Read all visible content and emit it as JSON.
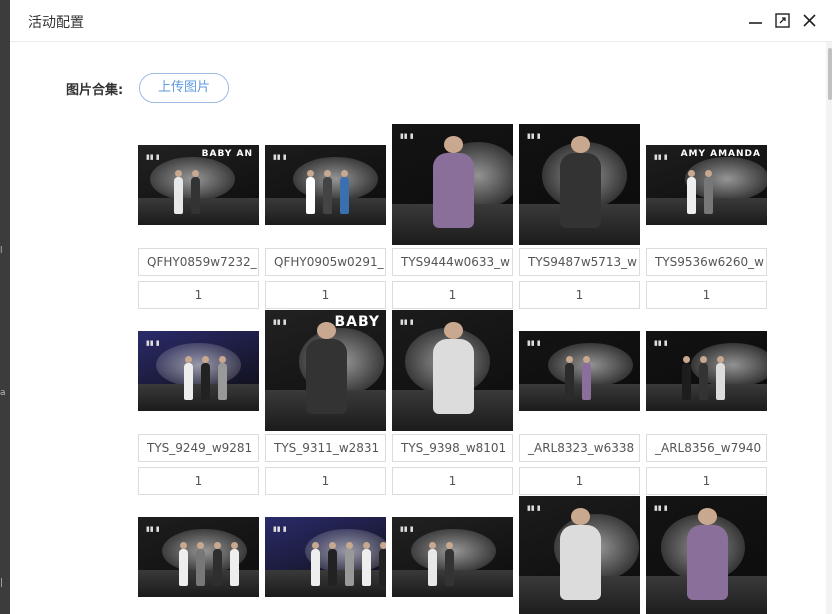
{
  "dialog": {
    "title": "活动配置",
    "icons": [
      "minimize-icon",
      "maximize-icon",
      "close-icon"
    ]
  },
  "form": {
    "label": "图片合集:",
    "upload_label": "上传图片"
  },
  "images": [
    {
      "name": "QFHY0859w7232_",
      "count": "1",
      "orientation": "landscape",
      "brand": "BABY AN"
    },
    {
      "name": "QFHY0905w0291_",
      "count": "1",
      "orientation": "landscape",
      "brand": ""
    },
    {
      "name": "TYS9444w0633_w",
      "count": "1",
      "orientation": "square",
      "brand": ""
    },
    {
      "name": "TYS9487w5713_w",
      "count": "1",
      "orientation": "square",
      "brand": ""
    },
    {
      "name": "TYS9536w6260_w",
      "count": "1",
      "orientation": "landscape",
      "brand": "AMY AMANDA"
    },
    {
      "name": "TYS_9249_w9281",
      "count": "1",
      "orientation": "landscape",
      "brand": ""
    },
    {
      "name": "TYS_9311_w2831",
      "count": "1",
      "orientation": "square",
      "brand": "BABY"
    },
    {
      "name": "TYS_9398_w8101",
      "count": "1",
      "orientation": "square",
      "brand": ""
    },
    {
      "name": "_ARL8323_w6338",
      "count": "1",
      "orientation": "landscape",
      "brand": ""
    },
    {
      "name": "_ARL8356_w7940",
      "count": "1",
      "orientation": "landscape",
      "brand": ""
    },
    {
      "name": "",
      "count": "",
      "orientation": "landscape",
      "brand": ""
    },
    {
      "name": "",
      "count": "",
      "orientation": "landscape",
      "brand": ""
    },
    {
      "name": "",
      "count": "",
      "orientation": "landscape",
      "brand": ""
    },
    {
      "name": "",
      "count": "",
      "orientation": "square",
      "brand": ""
    },
    {
      "name": "",
      "count": "",
      "orientation": "square",
      "brand": ""
    }
  ]
}
